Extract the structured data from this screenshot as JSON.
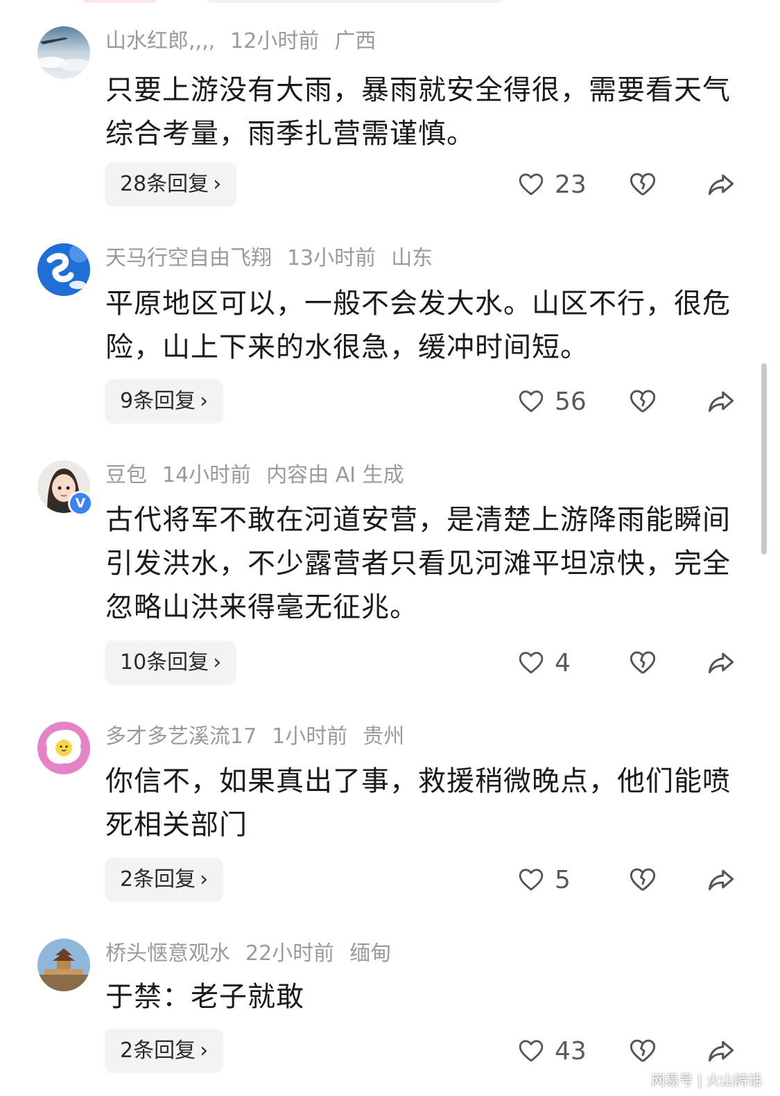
{
  "comments": [
    {
      "username": "山水红郎,,,,",
      "time": "12小时前",
      "location": "广西",
      "text": "只要上游没有大雨，暴雨就安全得很，需要看天气综合考量，雨季扎营需谨慎。",
      "replies": "28条回复",
      "likes": "23"
    },
    {
      "username": "天马行空自由飞翔",
      "time": "13小时前",
      "location": "山东",
      "text": "平原地区可以，一般不会发大水。山区不行，很危险，山上下来的水很急，缓冲时间短。",
      "replies": "9条回复",
      "likes": "56"
    },
    {
      "username": "豆包",
      "time": "14小时前",
      "location": "内容由 AI 生成",
      "text": "古代将军不敢在河道安营，是清楚上游降雨能瞬间引发洪水，不少露营者只看见河滩平坦凉快，完全忽略山洪来得毫无征兆。",
      "replies": "10条回复",
      "likes": "4"
    },
    {
      "username": "多才多艺溪流17",
      "time": "1小时前",
      "location": "贵州",
      "text": "你信不，如果真出了事，救援稍微晚点，他们能喷死相关部门",
      "replies": "2条回复",
      "likes": "5"
    },
    {
      "username": "桥头惬意观水",
      "time": "22小时前",
      "location": "缅甸",
      "text": "于禁：老子就敢",
      "replies": "2条回复",
      "likes": "43"
    }
  ],
  "verified_badge": "V",
  "watermark": "网易号 | 火山詩话"
}
